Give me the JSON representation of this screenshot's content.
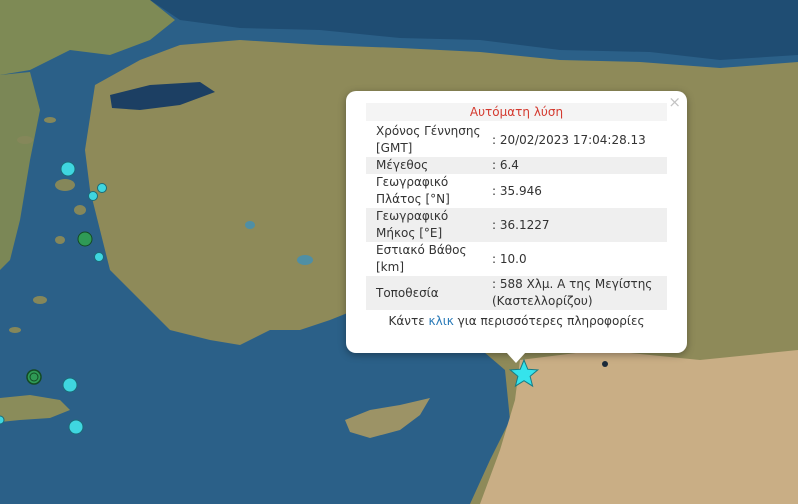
{
  "popup": {
    "title": "Αυτόματη λύση",
    "close_label": "×",
    "rows": [
      {
        "label": "Χρόνος Γέννησης [GMT]",
        "value": ": 20/02/2023 17:04:28.13"
      },
      {
        "label": "Μέγεθος",
        "value": ": 6.4"
      },
      {
        "label": "Γεωγραφικό Πλάτος [°N]",
        "value": ": 35.946"
      },
      {
        "label": "Γεωγραφικό Μήκος [°E]",
        "value": ": 36.1227"
      },
      {
        "label": "Εστιακό Βάθος [km]",
        "value": ": 10.0"
      },
      {
        "label": "Τοποθεσία",
        "value": ": 588 Χλμ. Α της Μεγίστης (Καστελλορίζου)"
      }
    ],
    "more_prefix": "Κάντε ",
    "more_link": "κλικ",
    "more_suffix": " για περισσότερες πληροφορίες"
  },
  "colors": {
    "sea": "#2a5f86",
    "land": "#8a8a58",
    "marker_cyan": "#3fd6e0",
    "marker_green": "#2f9a55",
    "star": "#35e3ec",
    "title_red": "#d43a2f"
  },
  "markers": [
    {
      "type": "circle",
      "color": "cyan",
      "size": "medium"
    },
    {
      "type": "circle",
      "color": "cyan",
      "size": "small"
    },
    {
      "type": "circle",
      "color": "cyan",
      "size": "small"
    },
    {
      "type": "circle",
      "color": "green",
      "size": "medium"
    },
    {
      "type": "circle",
      "color": "cyan",
      "size": "small"
    },
    {
      "type": "circle",
      "color": "green",
      "size": "medium"
    },
    {
      "type": "circle",
      "color": "cyan",
      "size": "medium"
    },
    {
      "type": "circle",
      "color": "cyan",
      "size": "medium"
    },
    {
      "type": "star",
      "color": "cyan",
      "size": "large"
    }
  ]
}
